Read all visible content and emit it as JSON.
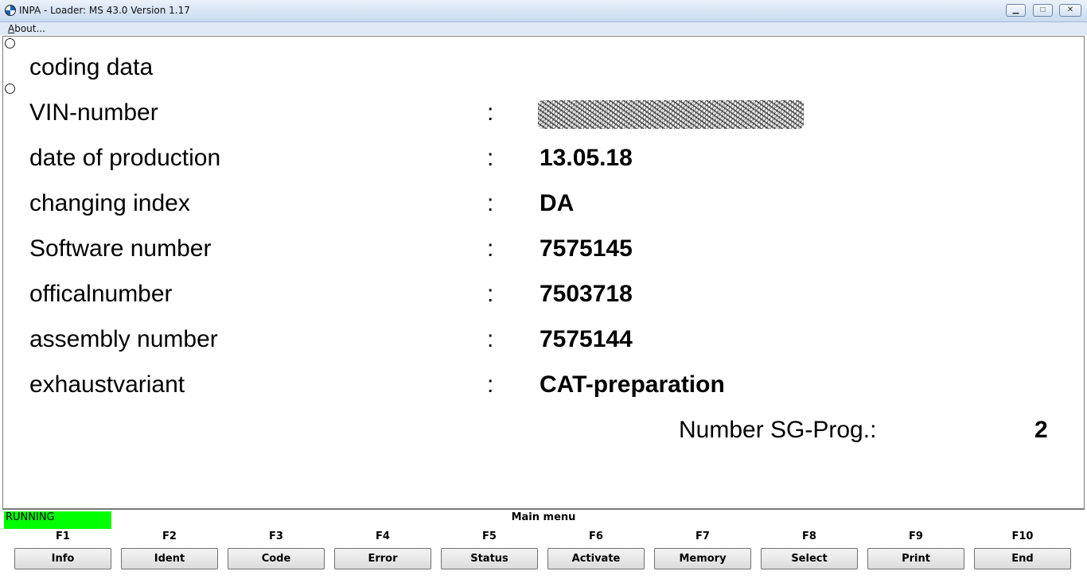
{
  "window": {
    "title": "INPA - Loader:  MS 43.0 Version 1.17",
    "minimize_icon": "minimize-icon",
    "maximize_icon": "maximize-icon",
    "close_icon": "close-icon"
  },
  "menu": {
    "about": "About..."
  },
  "coding": {
    "heading": "coding data",
    "rows": [
      {
        "label": "VIN-number",
        "separator": ":",
        "value": ""
      },
      {
        "label": "date of production",
        "separator": ":",
        "value": "13.05.18"
      },
      {
        "label": "changing index",
        "separator": ":",
        "value": "DA"
      },
      {
        "label": "Software number",
        "separator": ":",
        "value": "7575145"
      },
      {
        "label": "officalnumber",
        "separator": ":",
        "value": "7503718"
      },
      {
        "label": "assembly number",
        "separator": ":",
        "value": "7575144"
      },
      {
        "label": "exhaustvariant",
        "separator": ":",
        "value": "CAT-preparation"
      }
    ],
    "sg_prog_label": "Number SG-Prog.:",
    "sg_prog_value": "2"
  },
  "status": {
    "state": "RUNNING",
    "state_color": "#00ff00",
    "menu_title": "Main menu"
  },
  "function_keys": [
    {
      "key": "F1",
      "label": "Info"
    },
    {
      "key": "F2",
      "label": "Ident"
    },
    {
      "key": "F3",
      "label": "Code"
    },
    {
      "key": "F4",
      "label": "Error"
    },
    {
      "key": "F5",
      "label": "Status"
    },
    {
      "key": "F6",
      "label": "Activate"
    },
    {
      "key": "F7",
      "label": "Memory"
    },
    {
      "key": "F8",
      "label": "Select"
    },
    {
      "key": "F9",
      "label": "Print"
    },
    {
      "key": "F10",
      "label": "End"
    }
  ]
}
